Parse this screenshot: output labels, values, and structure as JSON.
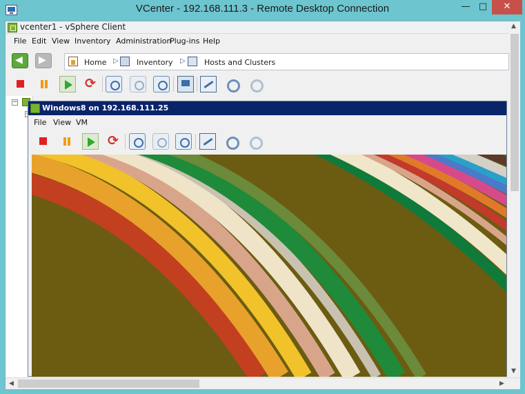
{
  "rdp": {
    "title": "VCenter - 192.168.111.3 - Remote Desktop Connection",
    "min": "—",
    "max": "□",
    "close": "✕"
  },
  "vsphere": {
    "title": "vcenter1 - vSphere Client",
    "menu": [
      "File",
      "Edit",
      "View",
      "Inventory",
      "Administration",
      "Plug-ins",
      "Help"
    ],
    "breadcrumb": {
      "home": "Home",
      "inventory": "Inventory",
      "hosts_clusters": "Hosts and Clusters"
    },
    "toolbar_icons": [
      "stop-icon",
      "pause-icon",
      "play-icon",
      "reset-icon",
      "snapshot-icon",
      "revert-snapshot-icon",
      "snapshot-manager-icon",
      "console-icon",
      "edit-settings-icon",
      "vm-tools-icon",
      "migrate-icon"
    ]
  },
  "vm": {
    "title": "Windows8 on 192.168.111.25",
    "menu": [
      "File",
      "View",
      "VM"
    ]
  },
  "colors": {
    "rdp_titlebar": "#6cc5cf",
    "close_button": "#c7504a",
    "vm_titlebar": "#0a246a",
    "vsphere_logo": "#7bb331"
  }
}
